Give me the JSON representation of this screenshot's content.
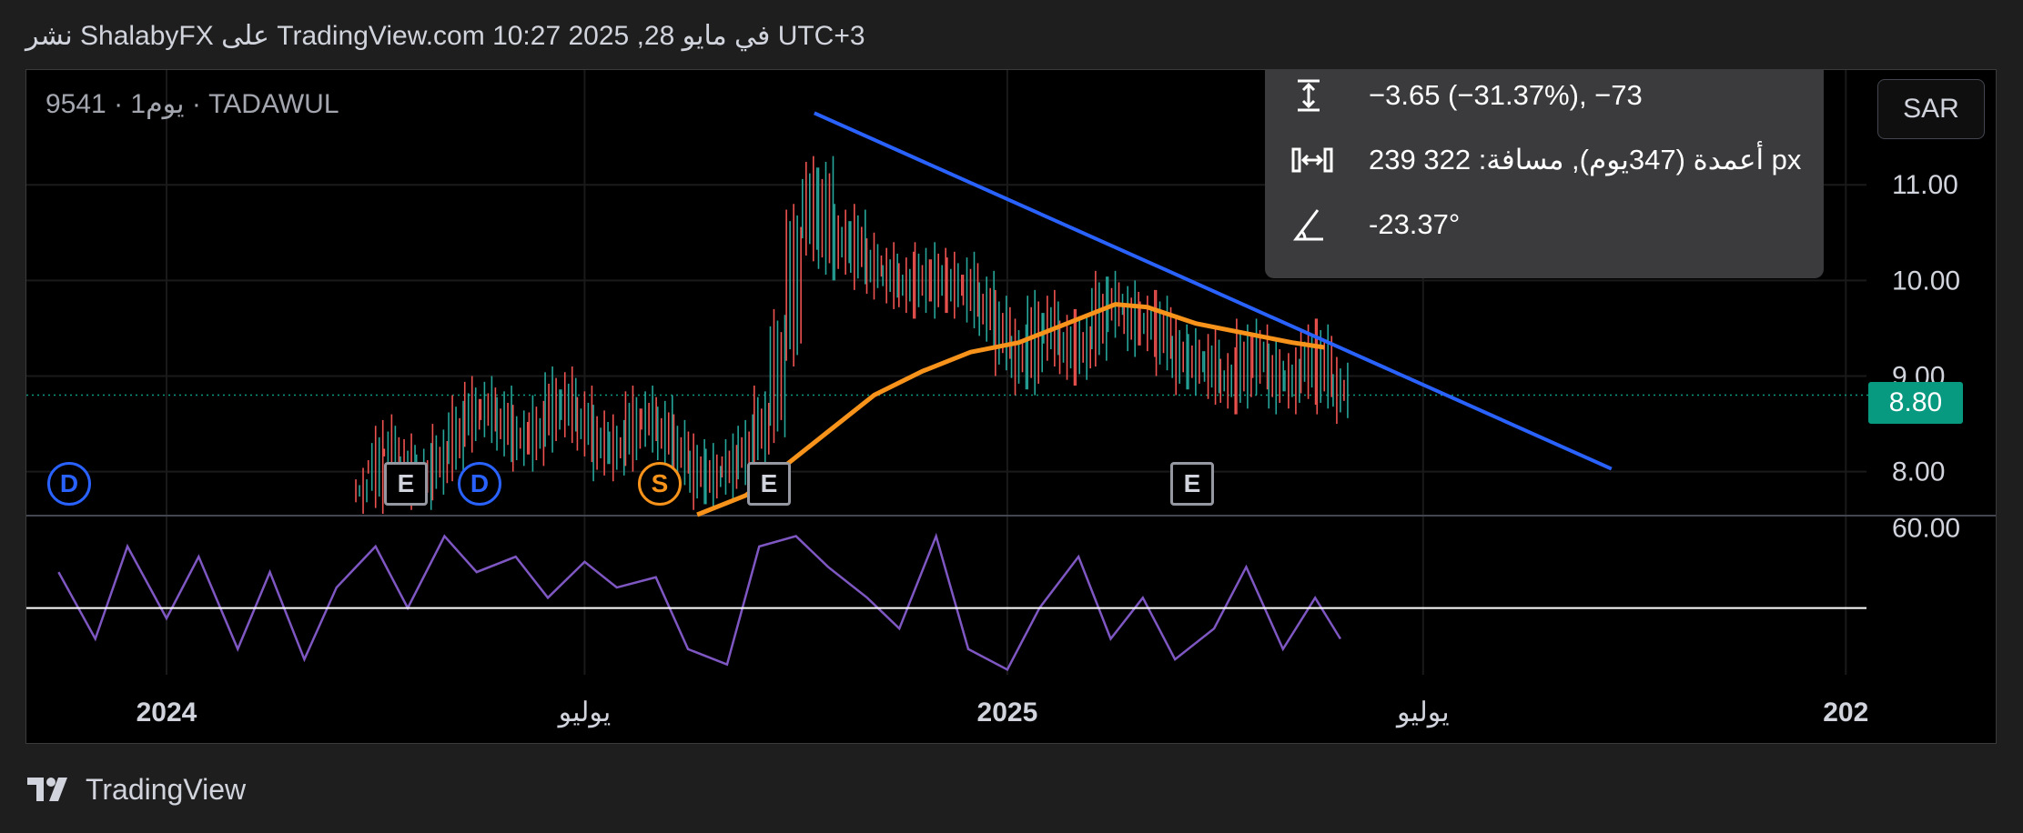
{
  "header": {
    "text": "نشر ShalabyFX على TradingView.com في مايو 28, 2025 10:27 UTC+3"
  },
  "symbol": {
    "label": "9541 · 1يوم · TADAWUL"
  },
  "currency_button": "SAR",
  "measure": {
    "price_change": "−3.65 (−31.37%), −73",
    "distance": "239 أعمدة (347يوم), مسافة: 322 px",
    "angle": "-23.37°"
  },
  "last_price": "8.80",
  "events": [
    {
      "type": "d",
      "label": "D"
    },
    {
      "type": "e",
      "label": "E"
    },
    {
      "type": "d",
      "label": "D"
    },
    {
      "type": "s",
      "label": "S"
    },
    {
      "type": "e",
      "label": "E"
    },
    {
      "type": "e",
      "label": "E"
    }
  ],
  "footer": {
    "brand": "TradingView"
  },
  "colors": {
    "up": "#26a69a",
    "down": "#ef5350",
    "trendline": "#2962ff",
    "ma": "#f7931a",
    "indicator": "#7e57c2",
    "badge": "#089981"
  },
  "chart_data": {
    "type": "candlestick",
    "price_axis": {
      "ticks": [
        "11.00",
        "10.00",
        "9.00",
        "8.00"
      ],
      "ylim": [
        7.55,
        12.2
      ]
    },
    "indicator_axis": {
      "ticks": [
        "60.00"
      ]
    },
    "time_axis": {
      "ticks": [
        "2024",
        "يوليو",
        "2025",
        "يوليو",
        "202"
      ]
    },
    "price_series": [
      {
        "date": "2024-03-25",
        "close": 7.8
      },
      {
        "date": "2024-04-01",
        "close": 8.3
      },
      {
        "date": "2024-04-08",
        "close": 8.1
      },
      {
        "date": "2024-04-15",
        "close": 7.9
      },
      {
        "date": "2024-04-22",
        "close": 8.0
      },
      {
        "date": "2024-04-29",
        "close": 8.2
      },
      {
        "date": "2024-05-06",
        "close": 8.5
      },
      {
        "date": "2024-05-13",
        "close": 8.7
      },
      {
        "date": "2024-05-20",
        "close": 8.6
      },
      {
        "date": "2024-05-27",
        "close": 8.4
      },
      {
        "date": "2024-06-03",
        "close": 8.3
      },
      {
        "date": "2024-06-10",
        "close": 8.5
      },
      {
        "date": "2024-06-17",
        "close": 8.8
      },
      {
        "date": "2024-06-24",
        "close": 8.6
      },
      {
        "date": "2024-07-01",
        "close": 8.4
      },
      {
        "date": "2024-07-08",
        "close": 8.2
      },
      {
        "date": "2024-07-15",
        "close": 8.3
      },
      {
        "date": "2024-07-22",
        "close": 8.6
      },
      {
        "date": "2024-07-29",
        "close": 8.5
      },
      {
        "date": "2024-08-05",
        "close": 8.3
      },
      {
        "date": "2024-08-12",
        "close": 8.1
      },
      {
        "date": "2024-08-19",
        "close": 7.9
      },
      {
        "date": "2024-08-26",
        "close": 8.0
      },
      {
        "date": "2024-09-02",
        "close": 8.1
      },
      {
        "date": "2024-09-09",
        "close": 8.3
      },
      {
        "date": "2024-09-16",
        "close": 8.6
      },
      {
        "date": "2024-09-23",
        "close": 9.4
      },
      {
        "date": "2024-09-30",
        "close": 10.5
      },
      {
        "date": "2024-10-07",
        "close": 11.0
      },
      {
        "date": "2024-10-14",
        "close": 10.3
      },
      {
        "date": "2024-10-21",
        "close": 10.5
      },
      {
        "date": "2024-10-28",
        "close": 10.2
      },
      {
        "date": "2024-11-04",
        "close": 10.1
      },
      {
        "date": "2024-11-11",
        "close": 10.0
      },
      {
        "date": "2024-11-18",
        "close": 9.9
      },
      {
        "date": "2024-11-25",
        "close": 10.1
      },
      {
        "date": "2024-12-02",
        "close": 9.9
      },
      {
        "date": "2024-12-09",
        "close": 10.0
      },
      {
        "date": "2024-12-16",
        "close": 9.8
      },
      {
        "date": "2024-12-23",
        "close": 9.6
      },
      {
        "date": "2024-12-30",
        "close": 9.3
      },
      {
        "date": "2025-01-06",
        "close": 9.1
      },
      {
        "date": "2025-01-13",
        "close": 9.6
      },
      {
        "date": "2025-01-20",
        "close": 9.4
      },
      {
        "date": "2025-01-27",
        "close": 9.2
      },
      {
        "date": "2025-02-03",
        "close": 9.4
      },
      {
        "date": "2025-02-10",
        "close": 9.8
      },
      {
        "date": "2025-02-17",
        "close": 9.7
      },
      {
        "date": "2025-02-24",
        "close": 9.5
      },
      {
        "date": "2025-03-03",
        "close": 9.6
      },
      {
        "date": "2025-03-10",
        "close": 9.3
      },
      {
        "date": "2025-03-17",
        "close": 9.1
      },
      {
        "date": "2025-03-24",
        "close": 9.2
      },
      {
        "date": "2025-03-31",
        "close": 9.0
      },
      {
        "date": "2025-04-07",
        "close": 8.9
      },
      {
        "date": "2025-04-14",
        "close": 9.3
      },
      {
        "date": "2025-04-21",
        "close": 9.1
      },
      {
        "date": "2025-04-28",
        "close": 8.9
      },
      {
        "date": "2025-05-05",
        "close": 9.0
      },
      {
        "date": "2025-05-12",
        "close": 9.3
      },
      {
        "date": "2025-05-19",
        "close": 8.9
      },
      {
        "date": "2025-05-26",
        "close": 8.8
      }
    ],
    "ma_series": [
      {
        "date": "2024-08-19",
        "value": 7.55
      },
      {
        "date": "2024-09-09",
        "value": 7.75
      },
      {
        "date": "2024-09-23",
        "value": 8.0
      },
      {
        "date": "2024-10-14",
        "value": 8.4
      },
      {
        "date": "2024-11-04",
        "value": 8.8
      },
      {
        "date": "2024-11-25",
        "value": 9.05
      },
      {
        "date": "2024-12-16",
        "value": 9.25
      },
      {
        "date": "2025-01-06",
        "value": 9.35
      },
      {
        "date": "2025-01-27",
        "value": 9.55
      },
      {
        "date": "2025-02-17",
        "value": 9.75
      },
      {
        "date": "2025-03-03",
        "value": 9.72
      },
      {
        "date": "2025-03-24",
        "value": 9.55
      },
      {
        "date": "2025-04-14",
        "value": 9.45
      },
      {
        "date": "2025-05-05",
        "value": 9.35
      },
      {
        "date": "2025-05-19",
        "value": 9.3
      }
    ],
    "trendline": [
      {
        "date": "2024-10-09",
        "value": 11.75
      },
      {
        "date": "2025-09-21",
        "value": 8.03
      }
    ],
    "indicator_series": [
      {
        "date": "2023-11-15",
        "value": 55
      },
      {
        "date": "2023-12-01",
        "value": 42
      },
      {
        "date": "2023-12-15",
        "value": 60
      },
      {
        "date": "2024-01-01",
        "value": 46
      },
      {
        "date": "2024-01-15",
        "value": 58
      },
      {
        "date": "2024-02-01",
        "value": 40
      },
      {
        "date": "2024-02-15",
        "value": 55
      },
      {
        "date": "2024-03-01",
        "value": 38
      },
      {
        "date": "2024-03-15",
        "value": 52
      },
      {
        "date": "2024-04-01",
        "value": 60
      },
      {
        "date": "2024-04-15",
        "value": 48
      },
      {
        "date": "2024-05-01",
        "value": 62
      },
      {
        "date": "2024-05-15",
        "value": 55
      },
      {
        "date": "2024-06-01",
        "value": 58
      },
      {
        "date": "2024-06-15",
        "value": 50
      },
      {
        "date": "2024-07-01",
        "value": 57
      },
      {
        "date": "2024-07-15",
        "value": 52
      },
      {
        "date": "2024-08-01",
        "value": 54
      },
      {
        "date": "2024-08-15",
        "value": 40
      },
      {
        "date": "2024-09-01",
        "value": 37
      },
      {
        "date": "2024-09-15",
        "value": 60
      },
      {
        "date": "2024-10-01",
        "value": 62
      },
      {
        "date": "2024-10-15",
        "value": 56
      },
      {
        "date": "2024-11-01",
        "value": 50
      },
      {
        "date": "2024-11-15",
        "value": 44
      },
      {
        "date": "2024-12-01",
        "value": 62
      },
      {
        "date": "2024-12-15",
        "value": 40
      },
      {
        "date": "2025-01-01",
        "value": 36
      },
      {
        "date": "2025-01-15",
        "value": 48
      },
      {
        "date": "2025-02-01",
        "value": 58
      },
      {
        "date": "2025-02-15",
        "value": 42
      },
      {
        "date": "2025-03-01",
        "value": 50
      },
      {
        "date": "2025-03-15",
        "value": 38
      },
      {
        "date": "2025-04-01",
        "value": 44
      },
      {
        "date": "2025-04-15",
        "value": 56
      },
      {
        "date": "2025-05-01",
        "value": 40
      },
      {
        "date": "2025-05-15",
        "value": 50
      },
      {
        "date": "2025-05-26",
        "value": 42
      }
    ],
    "indicator_level": 48
  }
}
